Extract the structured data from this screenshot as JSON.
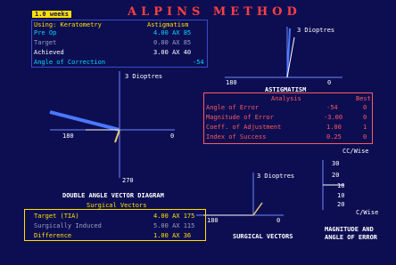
{
  "header": {
    "tag": "1.0 weeks",
    "title": "ALPINS METHOD"
  },
  "keratometry": {
    "heading_left": "Using: Keratometry",
    "heading_right": "Astigmatism",
    "rows": [
      {
        "label": "Pre Op",
        "value": "4.00 AX  85"
      },
      {
        "label": "Target",
        "value": "0.00 AX  85"
      },
      {
        "label": "Achieved",
        "value": "3.00 AX  40"
      },
      {
        "label": "Angle of Correction",
        "value": "-54"
      }
    ]
  },
  "astigmatism_plot": {
    "scale": "3 Dioptres",
    "label": "ASTIGMATISM",
    "left_tick": "180",
    "right_tick": "0"
  },
  "analysis": {
    "title": "Analysis",
    "col_best": "Best",
    "rows": [
      {
        "label": "Angle of Error",
        "value": "-54",
        "best": "0"
      },
      {
        "label": "Magnitude of Error",
        "value": "-3.00",
        "best": "0"
      },
      {
        "label": "Coeff. of Adjustment",
        "value": "1.00",
        "best": "1"
      },
      {
        "label": "Index of Success",
        "value": "0.25",
        "best": "0"
      }
    ]
  },
  "double_angle": {
    "scale": "3 Dioptres",
    "left_tick": "180",
    "right_tick": "0",
    "bottom_tick": "270",
    "label": "DOUBLE ANGLE VECTOR DIAGRAM"
  },
  "surgical_vectors": {
    "title": "Surgical Vectors",
    "target_label": "Target (TIA)",
    "target_value": "4.00 AX 175",
    "surgically_label": "Surgically Induced",
    "surgically_value": "5.00 AX 115",
    "difference_label": "Difference",
    "difference_value": "1.00 AX  36"
  },
  "surgical_plot": {
    "scale": "3 Dioptres",
    "label": "SURGICAL VECTORS",
    "left_tick": "180",
    "right_tick": "0"
  },
  "magnitude_plot": {
    "top_label": "CC/Wise",
    "ticks": [
      "30",
      "20",
      "10",
      "10",
      "20"
    ],
    "bottom_label": "C/Wise",
    "label_line1": "MAGNITUDE AND",
    "label_line2": "ANGLE OF ERROR"
  },
  "colors": {
    "background": "#0d0e52",
    "title": "#ff4040",
    "keratometry_border": "#3a4cc8",
    "analysis": "#ff5a5a",
    "axes": "#6f88ff",
    "vector_preop": "#4a78ff",
    "vector_achieved": "#e8c870",
    "tag": "#ffe000"
  }
}
